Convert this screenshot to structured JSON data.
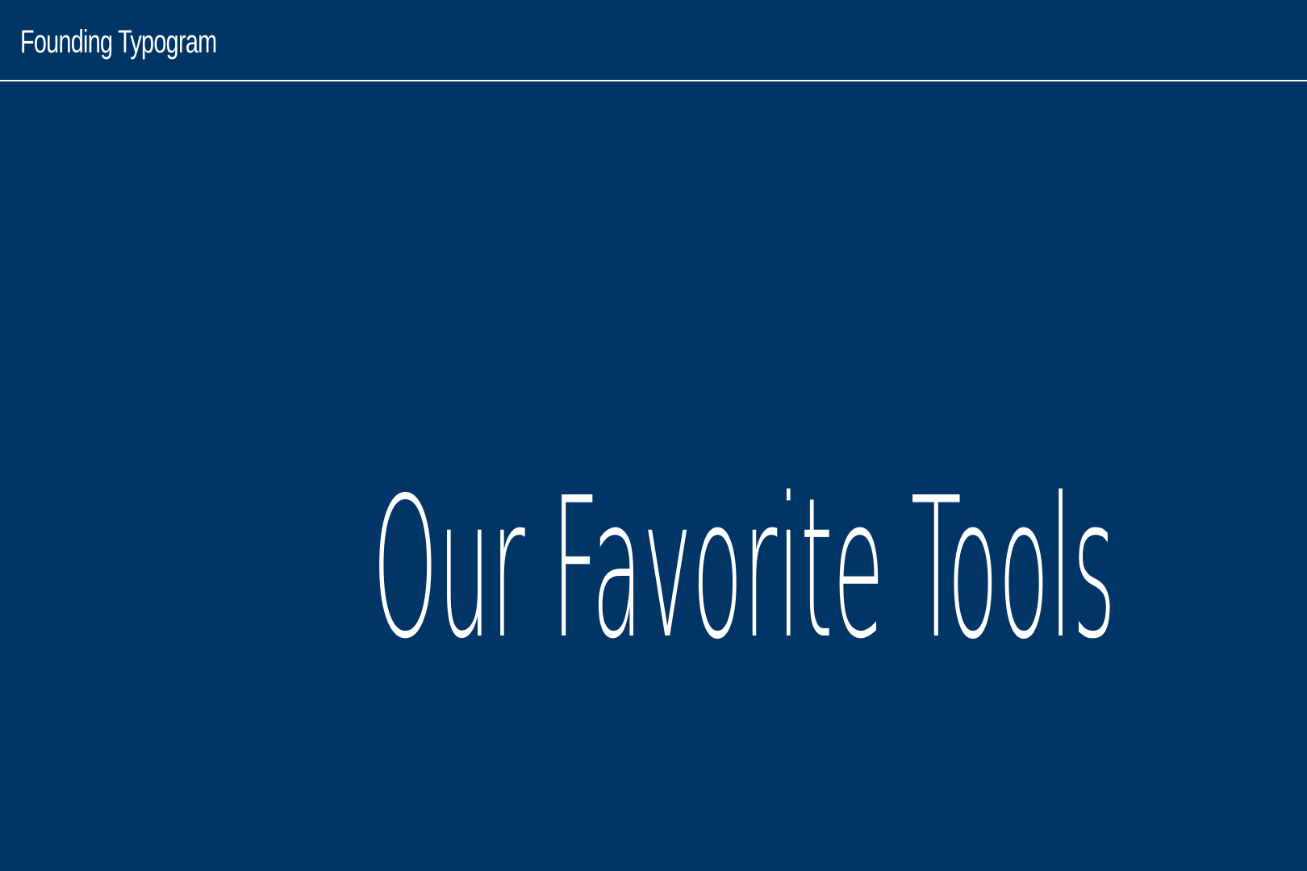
{
  "header": {
    "brand": "Founding Typogram"
  },
  "hero": {
    "title": "Our Favorite Tools"
  },
  "colors": {
    "background": "#013566",
    "text": "#ffffff"
  }
}
